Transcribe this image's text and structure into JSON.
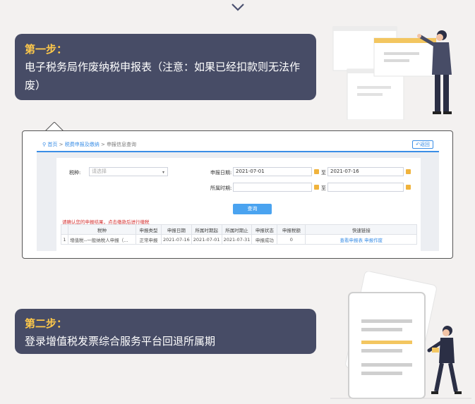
{
  "icons": {
    "chevron": "chevron-down-icon",
    "home": "location-pin-icon",
    "calendar": "calendar-icon",
    "back": "back-arrow-icon"
  },
  "colors": {
    "step_bg": "#474c66",
    "step_title": "#ffc94a",
    "accent_blue": "#3a8ee6",
    "warning": "#d32f2f"
  },
  "step1": {
    "title": "第一步：",
    "description": "电子税务局作废纳税申报表（注意：如果已经扣款则无法作废）"
  },
  "screenshot": {
    "breadcrumb": {
      "home": "首页",
      "sep1": ">",
      "section": "税费申报及缴纳",
      "sep2": ">",
      "current": "申报信息查询"
    },
    "back_label": "返回",
    "tax_type_label": "税种:",
    "tax_type_placeholder": "请选择",
    "declare_date_label": "申报日期:",
    "declare_date_from": "2021-07-01",
    "declare_date_to": "2021-07-16",
    "period_label": "所属时期:",
    "to_sep": "至",
    "query_button": "查询",
    "warning": "请确认您的申报结果，点击缴款后进行缴税",
    "table": {
      "headers": [
        "",
        "税种",
        "申报类型",
        "申报日期",
        "所属时期起",
        "所属时期止",
        "申报状态",
        "申报税额",
        "快速链接"
      ],
      "rows": [
        {
          "no": "1",
          "tax": "增值税--一般纳税人申报（...",
          "type": "正常申报",
          "date": "2021-07-16",
          "from": "2021-07-01",
          "to": "2021-07-31",
          "status": "申报成功",
          "amount": "0",
          "link1": "查看申报表",
          "link2": "申报作废"
        }
      ]
    }
  },
  "step2": {
    "title": "第二步：",
    "description": "登录增值税发票综合服务平台回退所属期"
  }
}
